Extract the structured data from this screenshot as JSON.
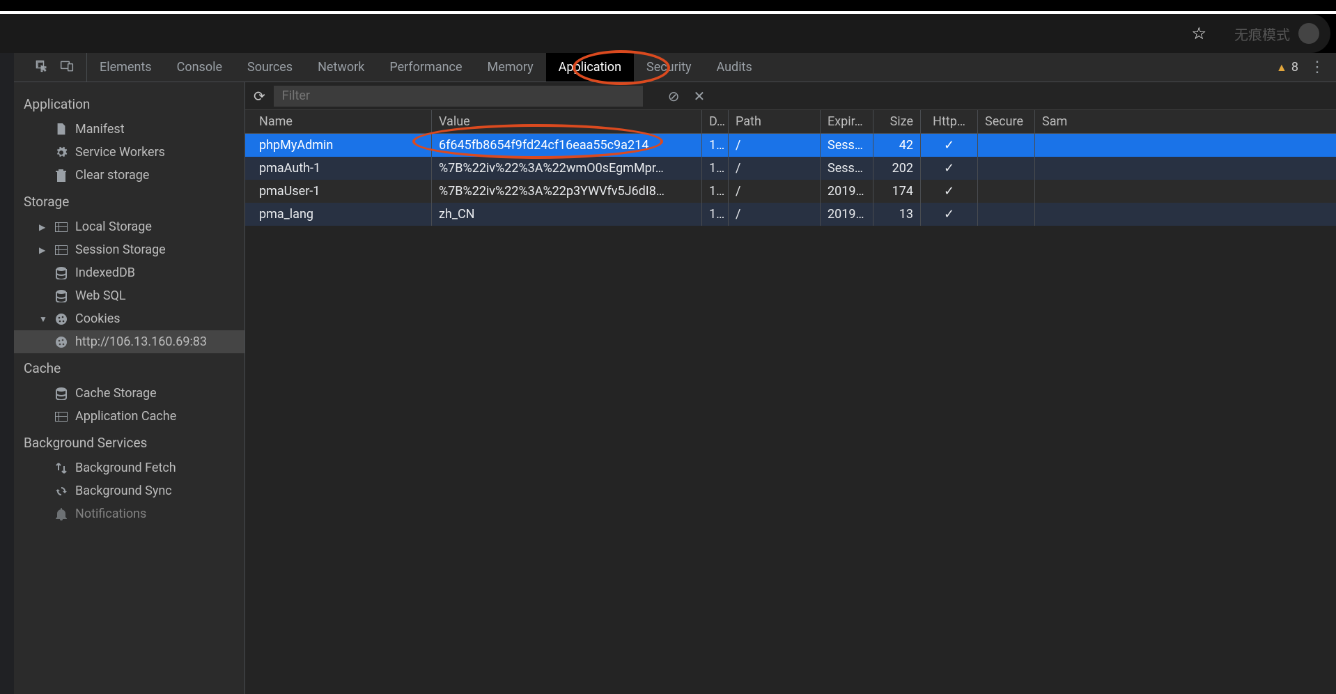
{
  "browser": {
    "incognito_label": "无痕模式"
  },
  "tabs": {
    "items": [
      "Elements",
      "Console",
      "Sources",
      "Network",
      "Performance",
      "Memory",
      "Application",
      "Security",
      "Audits"
    ],
    "active": "Application",
    "warn_count": "8"
  },
  "sidebar": {
    "section_application": "Application",
    "manifest": "Manifest",
    "service_workers": "Service Workers",
    "clear_storage": "Clear storage",
    "section_storage": "Storage",
    "local_storage": "Local Storage",
    "session_storage": "Session Storage",
    "indexeddb": "IndexedDB",
    "web_sql": "Web SQL",
    "cookies": "Cookies",
    "cookie_origin": "http://106.13.160.69:83",
    "section_cache": "Cache",
    "cache_storage": "Cache Storage",
    "application_cache": "Application Cache",
    "section_bg": "Background Services",
    "bg_fetch": "Background Fetch",
    "bg_sync": "Background Sync",
    "notifications": "Notifications"
  },
  "toolbar": {
    "filter_placeholder": "Filter"
  },
  "table": {
    "headers": {
      "name": "Name",
      "value": "Value",
      "domain": "D..",
      "path": "Path",
      "expires": "Expir…",
      "size": "Size",
      "http": "Http…",
      "secure": "Secure",
      "same": "Sam"
    },
    "rows": [
      {
        "name": "phpMyAdmin",
        "value": "6f645fb8654f9fd24cf16eaa55c9a214",
        "domain": "1…",
        "path": "/",
        "expires": "Sess…",
        "size": "42",
        "http": "✓",
        "secure": "",
        "selected": true
      },
      {
        "name": "pmaAuth-1",
        "value": "%7B%22iv%22%3A%22wmO0sEgmMpr…",
        "domain": "1…",
        "path": "/",
        "expires": "Sess…",
        "size": "202",
        "http": "✓",
        "secure": ""
      },
      {
        "name": "pmaUser-1",
        "value": "%7B%22iv%22%3A%22p3YWVfv5J6dI8…",
        "domain": "1…",
        "path": "/",
        "expires": "2019…",
        "size": "174",
        "http": "✓",
        "secure": ""
      },
      {
        "name": "pma_lang",
        "value": "zh_CN",
        "domain": "1…",
        "path": "/",
        "expires": "2019…",
        "size": "13",
        "http": "✓",
        "secure": ""
      }
    ]
  }
}
